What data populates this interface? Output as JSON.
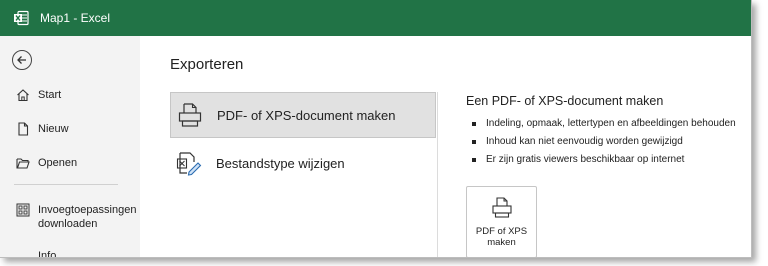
{
  "window": {
    "title": "Map1  -  Excel",
    "accent": "#217346",
    "app_icon": "excel-icon"
  },
  "sidebar": {
    "back_icon": "back-arrow-icon",
    "items": [
      {
        "label": "Start",
        "icon": "home-icon"
      },
      {
        "label": "Nieuw",
        "icon": "new-document-icon"
      },
      {
        "label": "Openen",
        "icon": "folder-icon"
      },
      {
        "label": "Invoegtoepassingen downloaden",
        "icon": "addins-icon"
      },
      {
        "label": "Info",
        "icon": "info-icon"
      }
    ]
  },
  "main": {
    "title": "Exporteren",
    "options": [
      {
        "label": "PDF- of XPS-document maken",
        "icon": "pdf-document-icon",
        "selected": true
      },
      {
        "label": "Bestandstype wijzigen",
        "icon": "change-filetype-icon",
        "selected": false
      }
    ],
    "details": {
      "heading": "Een PDF- of XPS-document maken",
      "bullets": [
        "Indeling, opmaak, lettertypen en afbeeldingen behouden",
        "Inhoud kan niet eenvoudig worden gewijzigd",
        "Er zijn gratis viewers beschikbaar op internet"
      ],
      "button_label": "PDF of XPS maken",
      "button_icon": "pdf-document-icon"
    }
  }
}
